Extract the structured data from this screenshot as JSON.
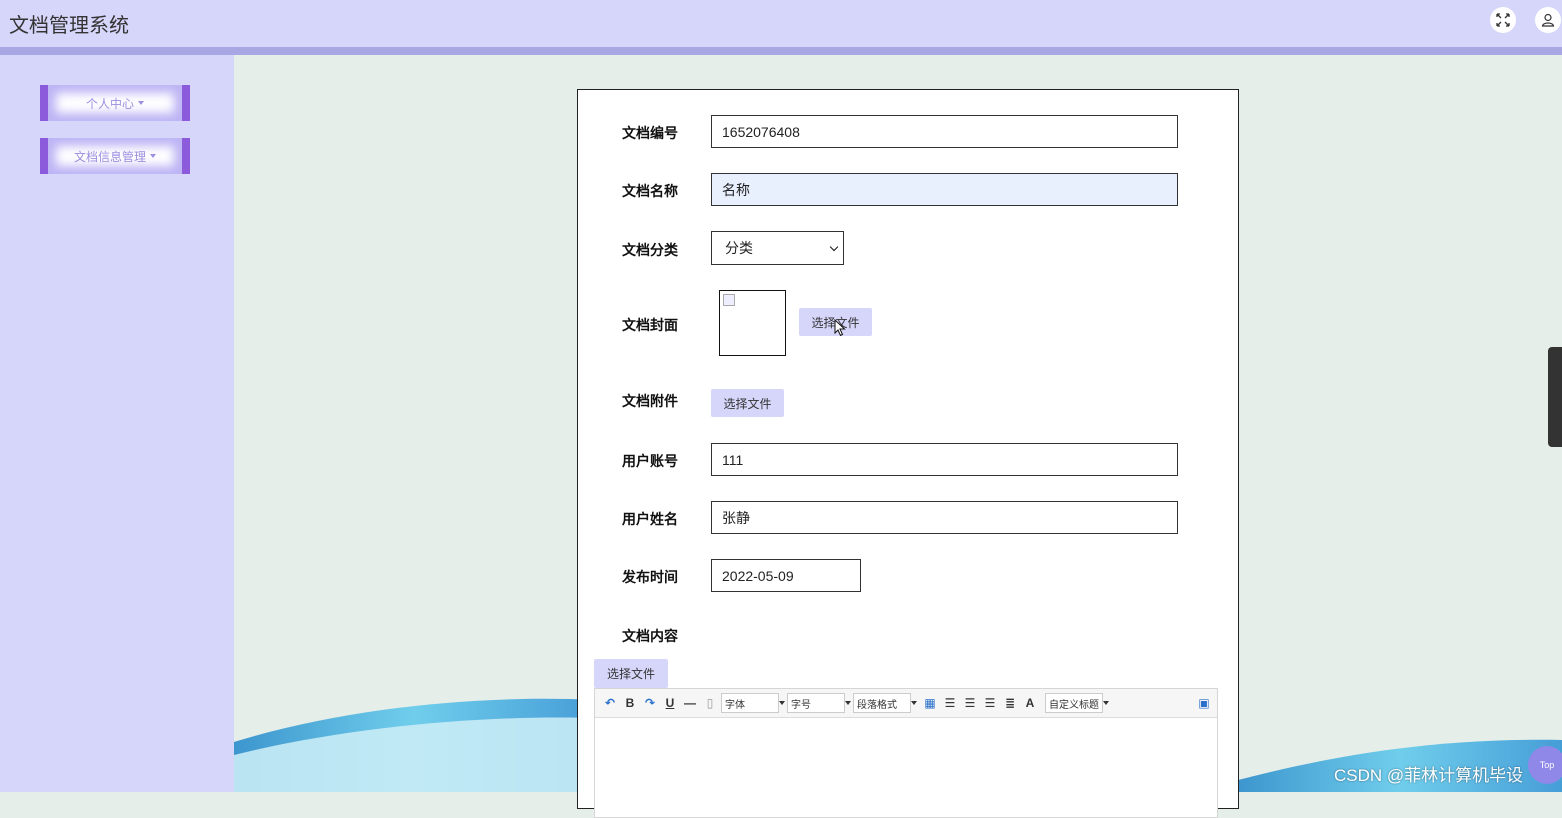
{
  "app": {
    "title": "文档管理系统"
  },
  "header": {
    "fullscreen_icon": "expand-arrows-icon",
    "user_icon": "user-icon"
  },
  "sidebar": {
    "items": [
      {
        "label": "个人中心"
      },
      {
        "label": "文档信息管理"
      }
    ]
  },
  "form": {
    "doc_number": {
      "label": "文档编号",
      "value": "1652076408"
    },
    "doc_name": {
      "label": "文档名称",
      "placeholder": "名称"
    },
    "doc_category": {
      "label": "文档分类",
      "selected": "分类"
    },
    "doc_cover": {
      "label": "文档封面",
      "button": "选择文件"
    },
    "doc_attachment": {
      "label": "文档附件",
      "button": "选择文件"
    },
    "user_account": {
      "label": "用户账号",
      "value": "111"
    },
    "user_name": {
      "label": "用户姓名",
      "value": "张静"
    },
    "publish_time": {
      "label": "发布时间",
      "value": "2022-05-09"
    },
    "doc_content": {
      "label": "文档内容",
      "button": "选择文件"
    }
  },
  "editor": {
    "font_family": "字体",
    "font_size": "字号",
    "paragraph_format": "段落格式",
    "custom_title": "自定义标题",
    "bold": "B",
    "underline": "U",
    "font_color": "A"
  },
  "widgets": {
    "back_to_top": "Top"
  },
  "watermark": "CSDN @菲林计算机毕设"
}
